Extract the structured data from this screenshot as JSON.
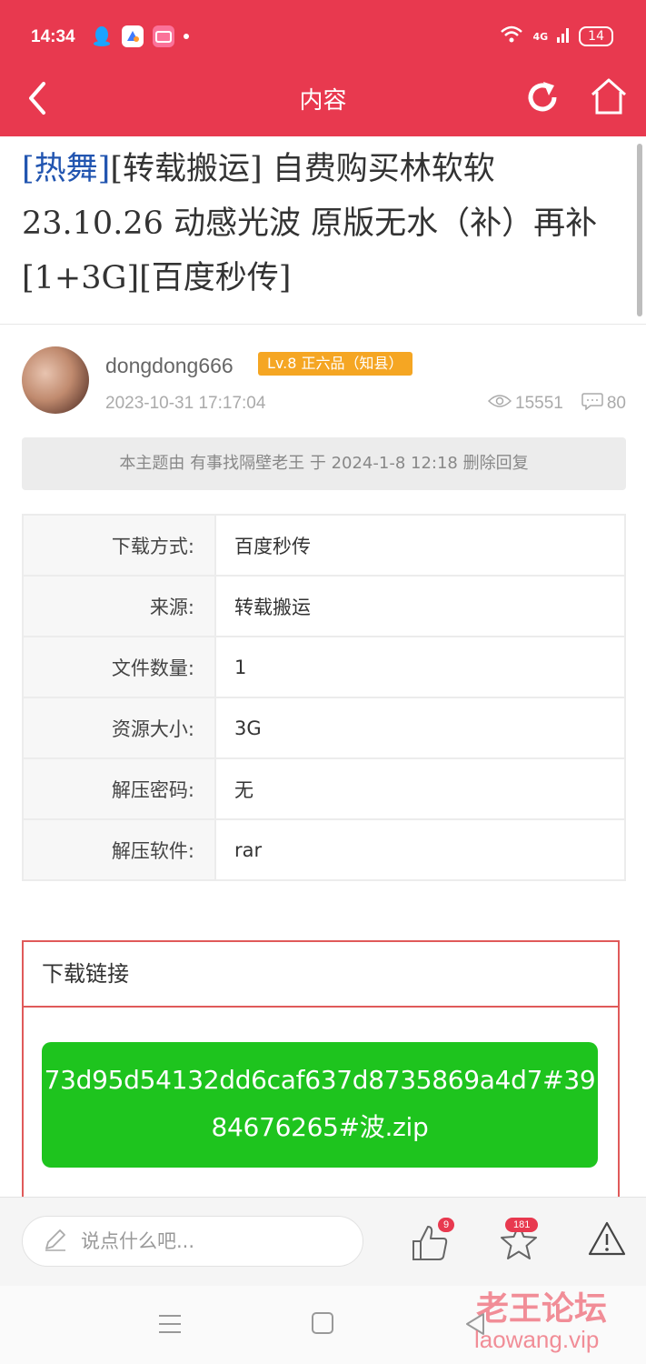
{
  "status_bar": {
    "time": "14:34",
    "network": "4G",
    "battery": "14",
    "app_icons": [
      "qq-icon",
      "app-icon",
      "bilibili-icon"
    ]
  },
  "nav": {
    "title": "内容",
    "icons": [
      "back-icon",
      "refresh-icon",
      "home-icon"
    ]
  },
  "post": {
    "title_tag": "[热舞]",
    "title_rest": "[转载搬运] 自费购买林软软23.10.26 动感光波 原版无水（补）再补 [1+3G][百度秒传]",
    "author": "dongdong666",
    "level": "Lv.8 正六品（知县）",
    "time": "2023-10-31 17:17:04",
    "views": "15551",
    "replies": "80",
    "notice": "本主题由 有事找隔壁老王 于 2024-1-8 12:18 删除回复"
  },
  "info_table": [
    {
      "label": "下载方式:",
      "value": "百度秒传"
    },
    {
      "label": "来源:",
      "value": "转载搬运"
    },
    {
      "label": "文件数量:",
      "value": "1"
    },
    {
      "label": "资源大小:",
      "value": "3G"
    },
    {
      "label": "解压密码:",
      "value": "无"
    },
    {
      "label": "解压软件:",
      "value": "rar"
    }
  ],
  "download": {
    "header": "下载链接",
    "link": "73d95d54132dd6caf637d8735869a4d7#3984676265#波.zip"
  },
  "bottom_bar": {
    "comment_placeholder": "说点什么吧...",
    "like_count": "9",
    "fav_count": "181"
  },
  "watermark": {
    "line1": "老王论坛",
    "line2": "laowang.vip"
  },
  "colors": {
    "brand_red": "#e8394f",
    "download_green": "#1ec41e",
    "level_orange": "#f5a623",
    "tag_blue": "#2255b0"
  }
}
